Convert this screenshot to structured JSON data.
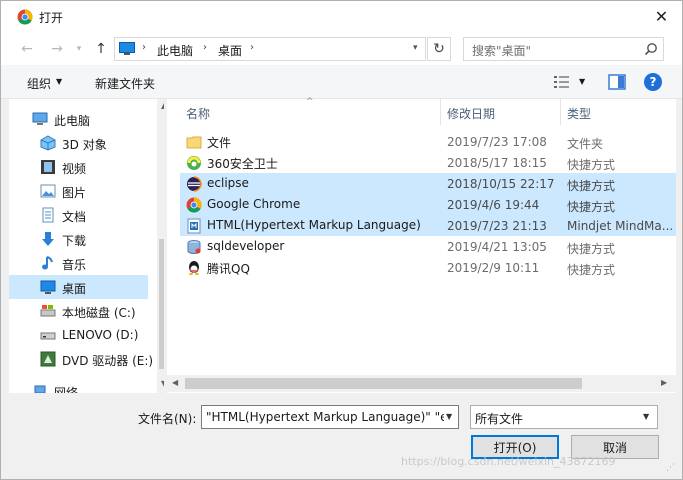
{
  "window": {
    "title": "打开",
    "close_icon": "close-icon"
  },
  "nav": {
    "address_segments": [
      "此电脑",
      "桌面"
    ],
    "search_placeholder": "搜索\"桌面\""
  },
  "toolbar": {
    "organize_label": "组织",
    "new_folder_label": "新建文件夹"
  },
  "sidebar": {
    "items": [
      {
        "label": "此电脑",
        "icon": "computer-icon"
      },
      {
        "label": "3D 对象",
        "icon": "3d-objects-icon"
      },
      {
        "label": "视频",
        "icon": "video-icon"
      },
      {
        "label": "图片",
        "icon": "pictures-icon"
      },
      {
        "label": "文档",
        "icon": "documents-icon"
      },
      {
        "label": "下载",
        "icon": "download-icon"
      },
      {
        "label": "音乐",
        "icon": "music-icon"
      },
      {
        "label": "桌面",
        "icon": "desktop-icon",
        "selected": true
      },
      {
        "label": "本地磁盘 (C:)",
        "icon": "local-disk-icon"
      },
      {
        "label": "LENOVO (D:)",
        "icon": "drive-icon"
      },
      {
        "label": "DVD 驱动器 (E:)",
        "icon": "dvd-drive-icon"
      },
      {
        "label": "网络",
        "icon": "network-icon"
      }
    ]
  },
  "list": {
    "columns": [
      "名称",
      "修改日期",
      "类型"
    ],
    "rows": [
      {
        "name": "文件",
        "date": "2019/7/23 17:08",
        "type": "文件夹",
        "icon": "folder-icon",
        "selected": false
      },
      {
        "name": "360安全卫士",
        "date": "2018/5/17 18:15",
        "type": "快捷方式",
        "icon": "360-safe-icon",
        "selected": false
      },
      {
        "name": "eclipse",
        "date": "2018/10/15 22:17",
        "type": "快捷方式",
        "icon": "eclipse-icon",
        "selected": true
      },
      {
        "name": "Google Chrome",
        "date": "2019/4/6 19:44",
        "type": "快捷方式",
        "icon": "chrome-icon",
        "selected": true
      },
      {
        "name": "HTML(Hypertext Markup Language)",
        "date": "2019/7/23 21:13",
        "type": "Mindjet MindMa...",
        "icon": "mindjet-file-icon",
        "selected": true
      },
      {
        "name": "sqldeveloper",
        "date": "2019/4/21 13:05",
        "type": "快捷方式",
        "icon": "sqldeveloper-icon",
        "selected": false
      },
      {
        "name": "腾讯QQ",
        "date": "2019/2/9 10:11",
        "type": "快捷方式",
        "icon": "qq-icon",
        "selected": false
      }
    ]
  },
  "bottom": {
    "filename_label": "文件名(N):",
    "filename_value": "\"HTML(Hypertext Markup Language)\" \"e",
    "filetype_value": "所有文件",
    "open_label": "打开(O)",
    "cancel_label": "取消"
  },
  "watermark": "https://blog.csdn.net/weixin_43872169",
  "colors": {
    "selection": "#cce8ff",
    "accent": "#0078d7",
    "help": "#1e6fd9"
  }
}
